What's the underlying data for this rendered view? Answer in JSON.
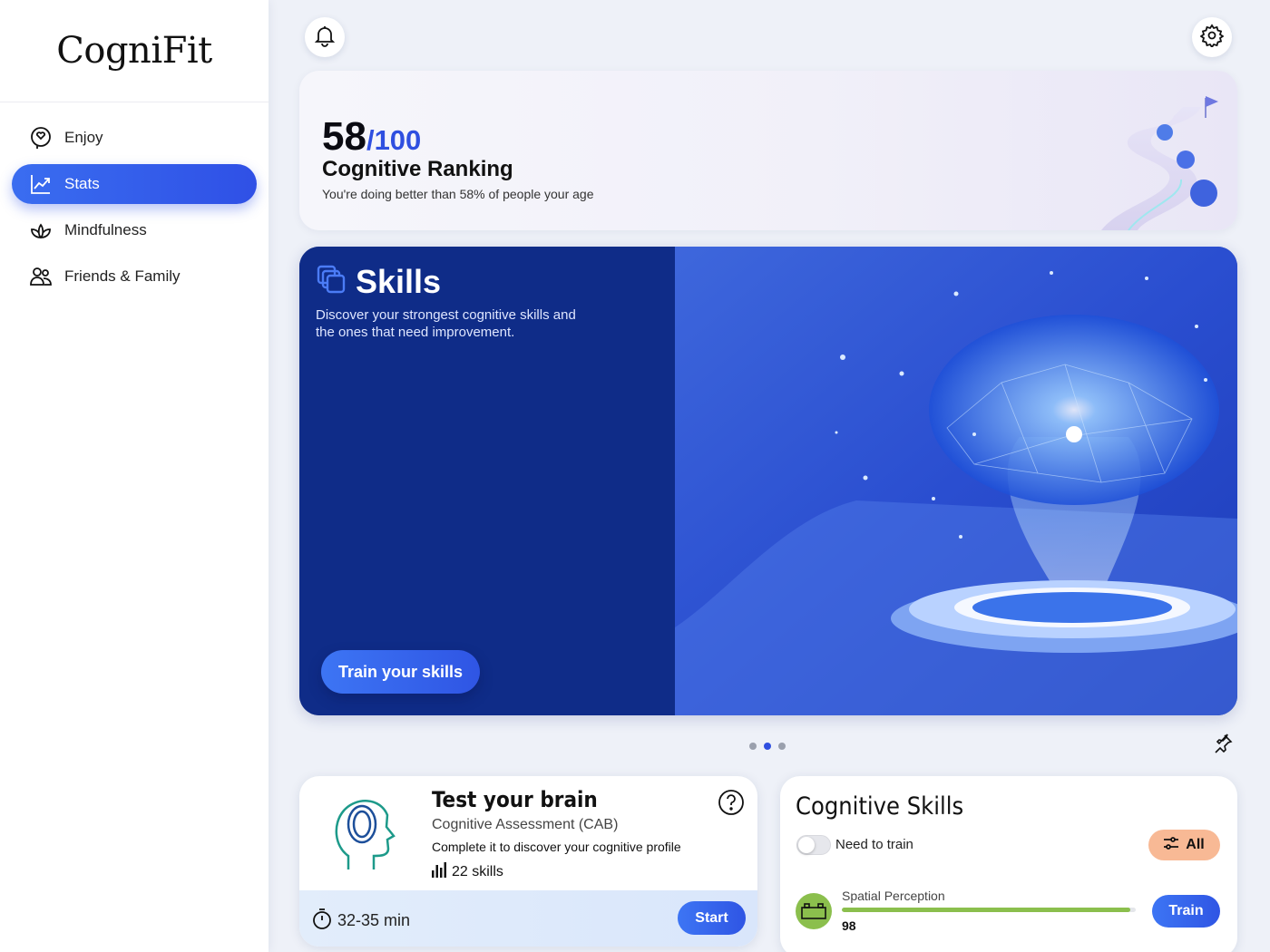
{
  "app": {
    "logo_text": "CogniFit"
  },
  "sidebar": {
    "items": [
      {
        "label": "Enjoy",
        "icon": "brain-heart-icon",
        "active": false
      },
      {
        "label": "Stats",
        "icon": "chart-line-icon",
        "active": true
      },
      {
        "label": "Mindfulness",
        "icon": "lotus-icon",
        "active": false
      },
      {
        "label": "Friends & Family",
        "icon": "people-icon",
        "active": false
      }
    ]
  },
  "topbar": {
    "notifications_icon": "bell-icon",
    "settings_icon": "gear-icon"
  },
  "ranking": {
    "score": "58",
    "max": "/100",
    "title": "Cognitive Ranking",
    "subtitle": "You're doing better than 58% of people your age"
  },
  "skills_banner": {
    "title": "Skills",
    "description": "Discover your strongest cognitive skills and the ones that need improvement.",
    "button_label": "Train your skills"
  },
  "carousel": {
    "count": 3,
    "active_index": 1
  },
  "test_card": {
    "title": "Test your brain",
    "subtitle": "Cognitive Assessment (CAB)",
    "description": "Complete it to discover your cognitive profile",
    "skills_count": "22 skills",
    "duration": "32-35 min",
    "start_label": "Start"
  },
  "cognitive_skills": {
    "title": "Cognitive Skills",
    "toggle_label": "Need to train",
    "toggle_on": false,
    "filter_label": "All",
    "skills": [
      {
        "name": "Spatial Perception",
        "score": "98",
        "progress": 0.98,
        "color": "#8bbf4d",
        "train_label": "Train"
      }
    ]
  },
  "colors": {
    "accent": "#2f4fe0",
    "banner_bg": "#0f2c88",
    "filter_bg": "#f8b995",
    "skill_green": "#8bbf4d"
  }
}
